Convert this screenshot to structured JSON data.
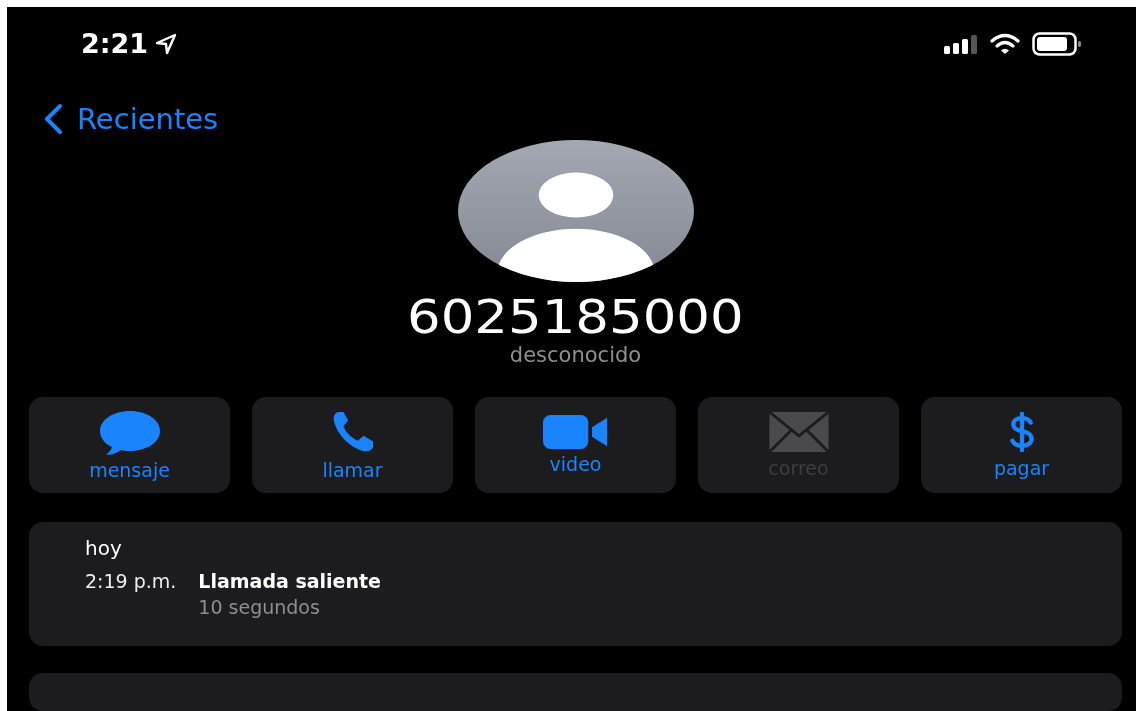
{
  "status_bar": {
    "time": "2:21"
  },
  "nav": {
    "back_label": "Recientes"
  },
  "contact": {
    "number": "6025185000",
    "label": "desconocido"
  },
  "actions": [
    {
      "kind": "message",
      "label": "mensaje",
      "disabled": false
    },
    {
      "kind": "call",
      "label": "llamar",
      "disabled": false
    },
    {
      "kind": "video",
      "label": "video",
      "disabled": false
    },
    {
      "kind": "mail",
      "label": "correo",
      "disabled": true
    },
    {
      "kind": "pay",
      "label": "pagar",
      "disabled": false
    }
  ],
  "history": {
    "day": "hoy",
    "entries": [
      {
        "time": "2:19 p.m.",
        "type": "Llamada saliente",
        "duration": "10 segundos"
      }
    ]
  }
}
